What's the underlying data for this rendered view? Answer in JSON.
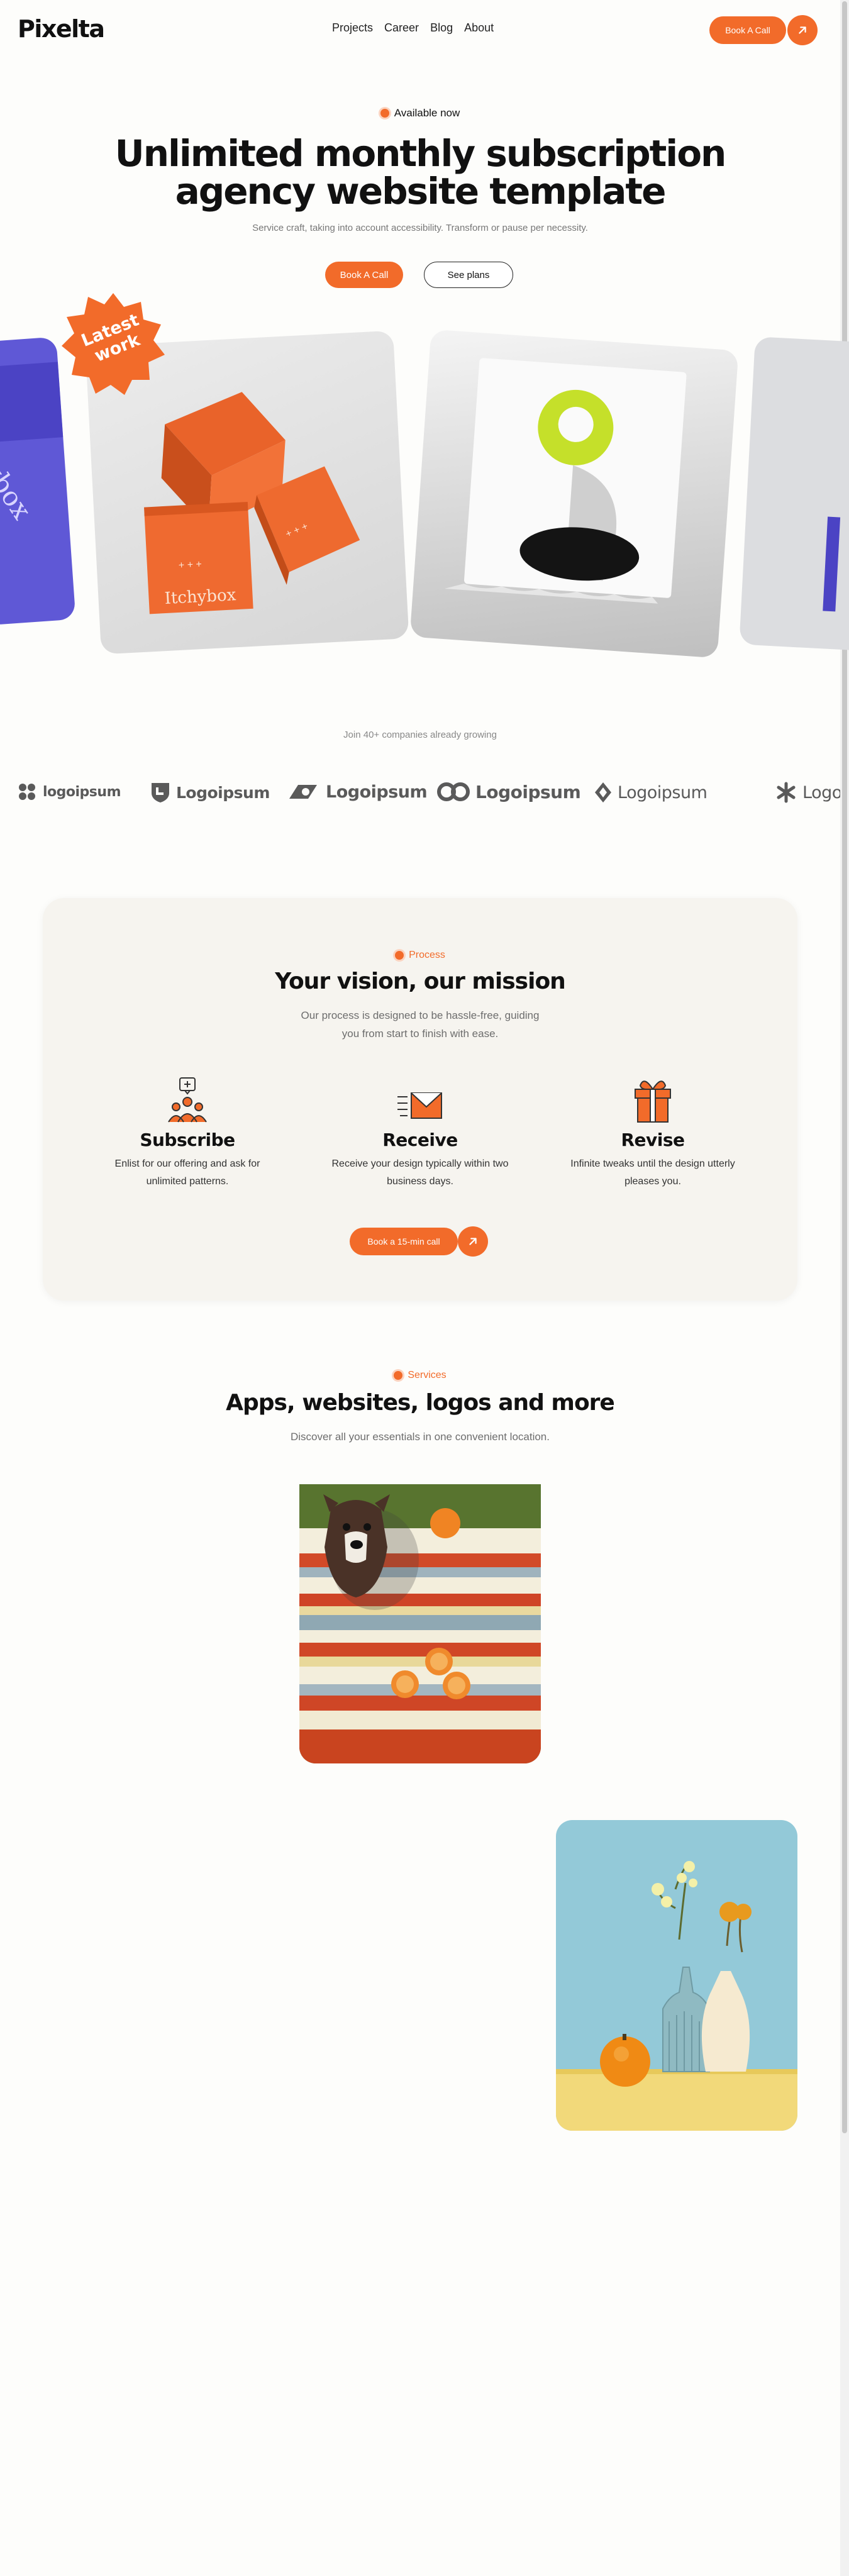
{
  "header": {
    "logo_text": "Pixelta",
    "nav": [
      "Projects",
      "Career",
      "Blog",
      "About"
    ],
    "cta_label": "Book A Call"
  },
  "hero": {
    "badge": "Available now",
    "title_line1": "Unlimited monthly subscription",
    "title_line2": "agency website template",
    "subtitle": "Service craft, taking into account accessibility. Transform or pause per necessity.",
    "primary_button": "Book A Call",
    "secondary_button": "See plans",
    "sticker_line1": "Latest",
    "sticker_line2": "work",
    "box_brand": "Itchybox"
  },
  "clients": {
    "caption": "Join 40+ companies already growing",
    "logos": [
      "logoipsum",
      "Logoipsum",
      "Logoipsum",
      "Logoipsum",
      "Logoipsum",
      "Logo"
    ]
  },
  "process": {
    "tag": "Process",
    "title": "Your vision, our mission",
    "desc_line1": "Our process is designed to be hassle-free, guiding",
    "desc_line2": "you from start to finish with ease.",
    "steps": [
      {
        "title": "Subscribe",
        "line1": "Enlist for our offering and ask for",
        "line2": "unlimited patterns.",
        "icon": "people-chat-icon"
      },
      {
        "title": "Receive",
        "line1": "Receive your design typically within two",
        "line2": "business days.",
        "icon": "envelope-icon"
      },
      {
        "title": "Revise",
        "line1": "Infinite tweaks until the design utterly",
        "line2": "pleases you.",
        "icon": "gift-icon"
      }
    ],
    "cta_label": "Book a 15-min call"
  },
  "services": {
    "tag": "Services",
    "title": "Apps, websites, logos and more",
    "subtitle": "Discover all your essentials in one convenient location."
  },
  "colors": {
    "accent": "#f26b2a",
    "background": "#fdfdfb",
    "panel": "#f6f4ef"
  }
}
